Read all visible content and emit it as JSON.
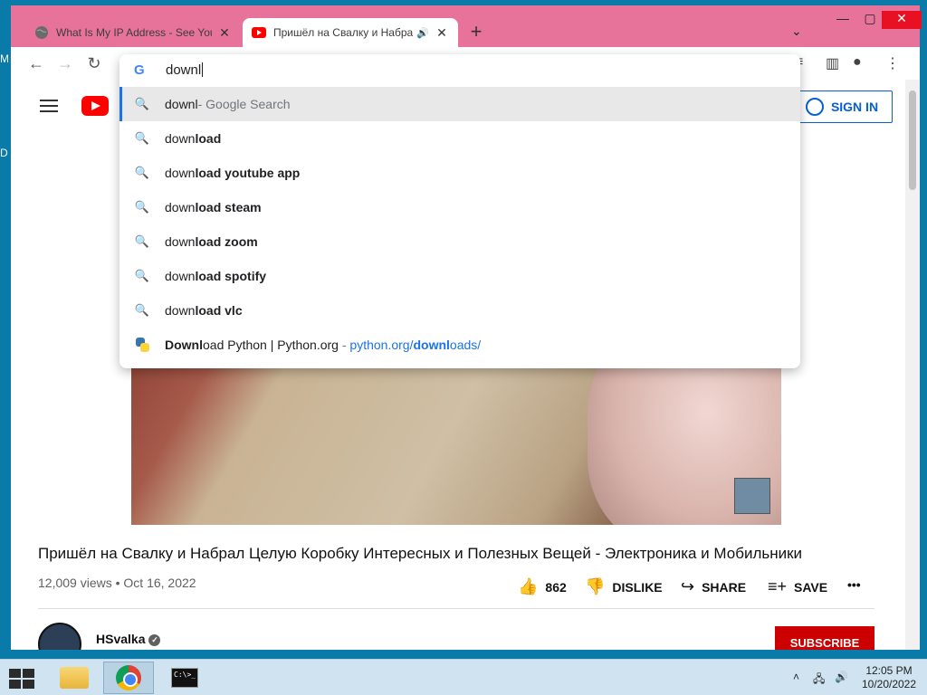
{
  "desktop": {
    "edge_chars": [
      "M",
      "D"
    ]
  },
  "browser": {
    "tabs": [
      {
        "title": "What Is My IP Address - See Your",
        "favicon": "globe-icon",
        "active": false
      },
      {
        "title": "Пришёл на Свалку и Набрал",
        "favicon": "youtube-icon",
        "active": true,
        "audio": true
      }
    ],
    "new_tab": "+",
    "omnibox": {
      "input_value": "downl",
      "suggestions": [
        {
          "typed": "downl",
          "rest": "",
          "suffix": " - Google Search",
          "icon": "search-icon",
          "selected": true
        },
        {
          "typed": "down",
          "rest": "load",
          "icon": "search-icon"
        },
        {
          "typed": "down",
          "rest": "load youtube app",
          "icon": "search-icon"
        },
        {
          "typed": "down",
          "rest": "load steam",
          "icon": "search-icon"
        },
        {
          "typed": "down",
          "rest": "load zoom",
          "icon": "search-icon"
        },
        {
          "typed": "down",
          "rest": "load spotify",
          "icon": "search-icon"
        },
        {
          "typed": "down",
          "rest": "load vlc",
          "icon": "search-icon"
        }
      ],
      "history_suggestion": {
        "title_bold": "Downl",
        "title_rest": "oad Python | Python.org",
        "separator": " - ",
        "url_prefix": "python.org/",
        "url_bold": "downl",
        "url_rest": "oads/",
        "icon": "python-icon"
      }
    }
  },
  "youtube": {
    "sign_in": "SIGN IN",
    "video_title": "Пришёл на Свалку и Набрал Целую Коробку Интересных и Полезных Вещей - Электроника и Мобильники",
    "meta": "12,009 views • Oct 16, 2022",
    "likes": "862",
    "dislike": "DISLIKE",
    "share": "SHARE",
    "save": "SAVE",
    "more": "•••",
    "channel": "HSvalka",
    "subscribe": "SUBSCRIBE"
  },
  "taskbar": {
    "time": "12:05 PM",
    "date": "10/20/2022",
    "cmd_text": "C:\\>_"
  }
}
